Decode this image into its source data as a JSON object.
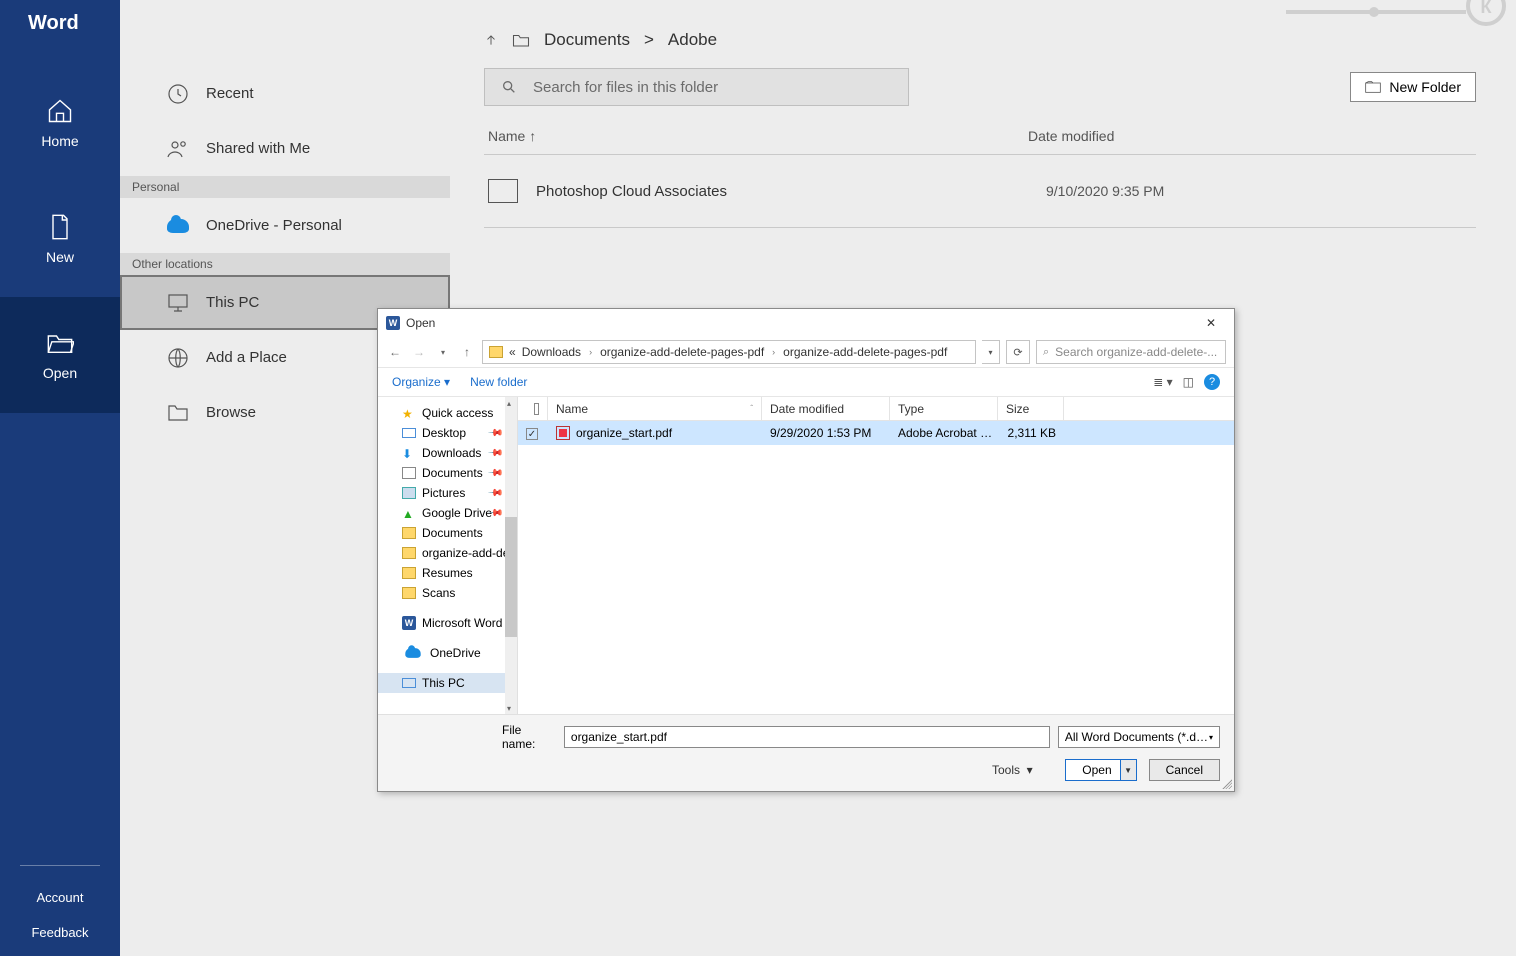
{
  "brand": "Word",
  "sidebar": {
    "items": [
      {
        "label": "Home"
      },
      {
        "label": "New"
      },
      {
        "label": "Open"
      }
    ],
    "bottom": [
      "Account",
      "Feedback"
    ]
  },
  "open_title": "Open",
  "locations": {
    "items": [
      {
        "label": "Recent"
      },
      {
        "label": "Shared with Me"
      }
    ],
    "cat1": "Personal",
    "onedrive": "OneDrive - Personal",
    "cat2": "Other locations",
    "others": [
      {
        "label": "This PC",
        "sel": true
      },
      {
        "label": "Add a Place"
      },
      {
        "label": "Browse"
      }
    ]
  },
  "main": {
    "crumb1": "Documents",
    "crumb2": "Adobe",
    "search_placeholder": "Search for files in this folder",
    "newfolder": "New Folder",
    "col_name": "Name",
    "col_date": "Date modified",
    "row1_name": "Photoshop Cloud Associates",
    "row1_date": "9/10/2020 9:35 PM"
  },
  "dialog": {
    "title": "Open",
    "path": {
      "p1": "Downloads",
      "p2": "organize-add-delete-pages-pdf",
      "p3": "organize-add-delete-pages-pdf",
      "ellipsis": "«"
    },
    "search_ph": "Search organize-add-delete-...",
    "organize": "Organize",
    "newfolder": "New folder",
    "tree": [
      {
        "label": "Quick access",
        "icon": "star"
      },
      {
        "label": "Desktop",
        "icon": "mon",
        "pin": true
      },
      {
        "label": "Downloads",
        "icon": "dl",
        "pin": true
      },
      {
        "label": "Documents",
        "icon": "doc",
        "pin": true
      },
      {
        "label": "Pictures",
        "icon": "pic",
        "pin": true
      },
      {
        "label": "Google Drive",
        "icon": "drive",
        "pin": true
      },
      {
        "label": "Documents",
        "icon": "folder"
      },
      {
        "label": "organize-add-de",
        "icon": "folder"
      },
      {
        "label": "Resumes",
        "icon": "folder"
      },
      {
        "label": "Scans",
        "icon": "folder"
      },
      {
        "label": "Microsoft Word",
        "icon": "word",
        "gap": true
      },
      {
        "label": "OneDrive",
        "icon": "cloud",
        "gap": true
      },
      {
        "label": "This PC",
        "icon": "mon",
        "sel": true,
        "gap": true
      }
    ],
    "cols": {
      "name": "Name",
      "date": "Date modified",
      "type": "Type",
      "size": "Size"
    },
    "file": {
      "name": "organize_start.pdf",
      "date": "9/29/2020 1:53 PM",
      "type": "Adobe Acrobat D...",
      "size": "2,311 KB"
    },
    "fn_label": "File name:",
    "fn_value": "organize_start.pdf",
    "filter": "All Word Documents (*.docx;*.d",
    "tools": "Tools",
    "open": "Open",
    "cancel": "Cancel"
  }
}
